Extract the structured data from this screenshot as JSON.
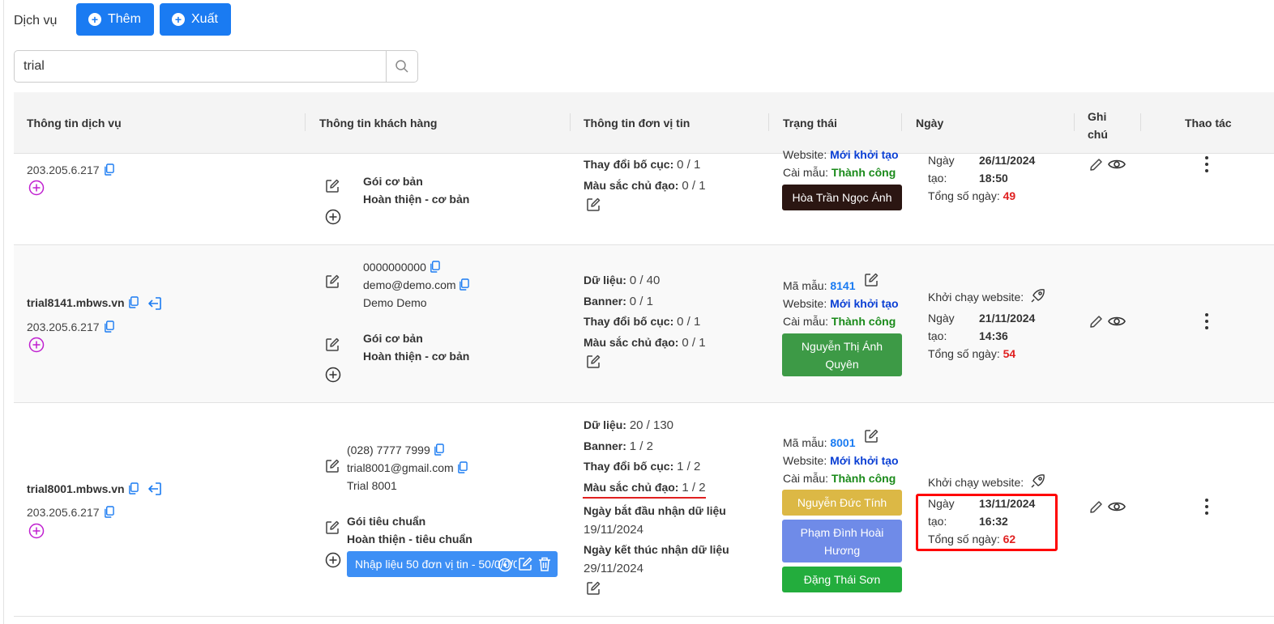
{
  "header": {
    "title": "Dịch vụ",
    "add_label": "Thêm",
    "export_label": "Xuất"
  },
  "search": {
    "value": "trial",
    "placeholder": ""
  },
  "table": {
    "columns": [
      "Thông tin dịch vụ",
      "Thông tin khách hàng",
      "Thông tin đơn vị tin",
      "Trạng thái",
      "Ngày",
      "Ghi chú",
      "Thao tác"
    ],
    "rows": [
      {
        "domain": "",
        "ip": "203.205.6.217",
        "package": "Gói cơ bản",
        "package_detail": "Hoàn thiện - cơ bản",
        "unit_items": [
          {
            "label": "Thay đổi bố cục:",
            "value": "0 / 1"
          },
          {
            "label": "Màu sắc chủ đạo:",
            "value": "0 / 1"
          }
        ],
        "website_label": "Website:",
        "website_status": "Mới khởi tạo",
        "template_label": "Cài mẫu:",
        "template_status": "Thành công",
        "staff": [
          "Hòa Trần Ngọc Ánh"
        ],
        "created_label_1": "Ngày",
        "created_label_2": "tạo:",
        "created_date": "26/11/2024",
        "created_time": "18:50",
        "total_days_label": "Tổng số ngày:",
        "total_days": "49"
      },
      {
        "domain": "trial8141.mbws.vn",
        "ip": "203.205.6.217",
        "phone": "0000000000",
        "email": "demo@demo.com",
        "name": "Demo Demo",
        "package": "Gói cơ bản",
        "package_detail": "Hoàn thiện - cơ bản",
        "unit_items": [
          {
            "label": "Dữ liệu:",
            "value": "0 / 40"
          },
          {
            "label": "Banner:",
            "value": "0 / 1"
          },
          {
            "label": "Thay đổi bố cục:",
            "value": "0 / 1"
          },
          {
            "label": "Màu sắc chủ đạo:",
            "value": "0 / 1"
          }
        ],
        "template_code_label": "Mã mẫu:",
        "template_code": "8141",
        "website_label": "Website:",
        "website_status": "Mới khởi tạo",
        "template_label": "Cài mẫu:",
        "template_status": "Thành công",
        "staff": [
          "Nguyễn Thị Ánh Quyên"
        ],
        "launch_label": "Khởi chạy website:",
        "created_label_1": "Ngày",
        "created_label_2": "tạo:",
        "created_date": "21/11/2024",
        "created_time": "14:36",
        "total_days_label": "Tổng số ngày:",
        "total_days": "54"
      },
      {
        "domain": "trial8001.mbws.vn",
        "ip": "203.205.6.217",
        "phone": "(028) 7777 7999",
        "email": "trial8001@gmail.com",
        "name": "Trial 8001",
        "package": "Gói tiêu chuẩn",
        "package_detail": "Hoàn thiện - tiêu chuẩn",
        "addon": "Nhập liệu 50 đơn vị tin - 50/0/0/0",
        "unit_items": [
          {
            "label": "Dữ liệu:",
            "value": "20 / 130"
          },
          {
            "label": "Banner:",
            "value": "1 / 2"
          },
          {
            "label": "Thay đổi bố cục:",
            "value": "1 / 2"
          },
          {
            "label": "Màu sắc chủ đạo:",
            "value": "1 / 2"
          }
        ],
        "start_label": "Ngày bắt đầu nhận dữ liệu",
        "start_date": "19/11/2024",
        "end_label": "Ngày kết thúc nhận dữ liệu",
        "end_date": "29/11/2024",
        "template_code_label": "Mã mẫu:",
        "template_code": "8001",
        "website_label": "Website:",
        "website_status": "Mới khởi tạo",
        "template_label": "Cài mẫu:",
        "template_status": "Thành công",
        "staff": [
          "Nguyễn Đức Tính",
          "Phạm Đình Hoài Hương",
          "Đặng Thái Sơn"
        ],
        "launch_label": "Khởi chạy website:",
        "created_label_1": "Ngày",
        "created_label_2": "tạo:",
        "created_date": "13/11/2024",
        "created_time": "16:32",
        "total_days_label": "Tổng số ngày:",
        "total_days": "62"
      }
    ]
  },
  "colors": {
    "primary": "#1a7bf2",
    "status_blue": "#0a3fd4",
    "status_green": "#1a8a1a",
    "days_red": "#e02020",
    "highlight": "#ff0000"
  }
}
